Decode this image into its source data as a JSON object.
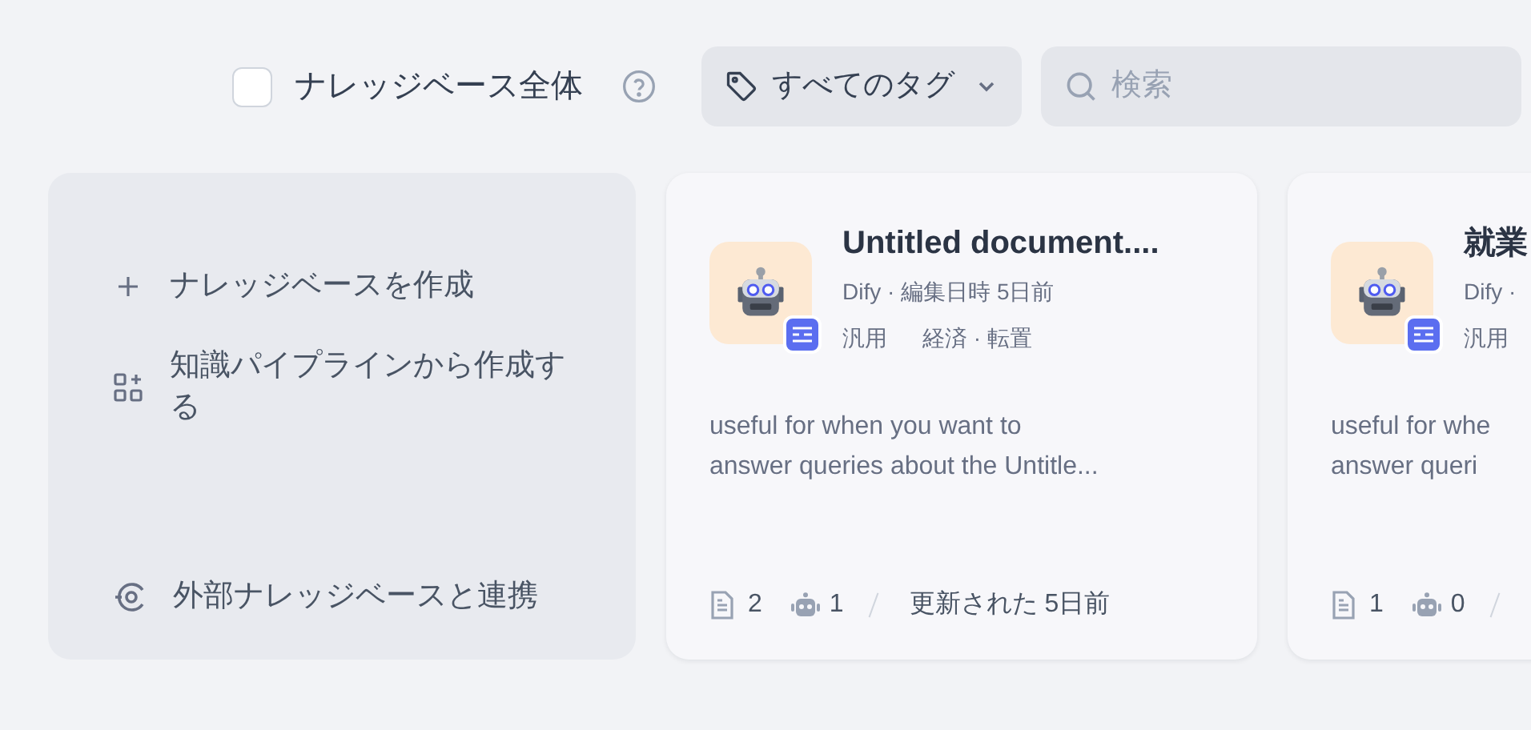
{
  "filter": {
    "all_label": "ナレッジベース全体",
    "all_checked": false,
    "tag_button": "すべてのタグ",
    "search": {
      "placeholder": "検索"
    }
  },
  "create_card": {
    "items": [
      {
        "kind": "create",
        "label": "ナレッジベースを作成"
      },
      {
        "kind": "pipeline",
        "label": "知識パイプラインから作成する"
      },
      {
        "kind": "external",
        "label": "外部ナレッジベースと連携"
      }
    ]
  },
  "knowledge_bases": [
    {
      "title": "Untitled document....",
      "meta": "Dify · 編集日時 5日前",
      "mode": "汎用",
      "index": "経済 · 転置",
      "description_lines": [
        "useful for when you want to",
        "answer queries about the Untitle..."
      ],
      "documents": "2",
      "apps": "1",
      "updated": "更新された 5日前"
    },
    {
      "title": "就業",
      "meta": "Dify ·",
      "mode": "汎用",
      "description_lines": [
        "useful for whe",
        "answer queri"
      ],
      "documents": "1",
      "apps": "0"
    }
  ]
}
